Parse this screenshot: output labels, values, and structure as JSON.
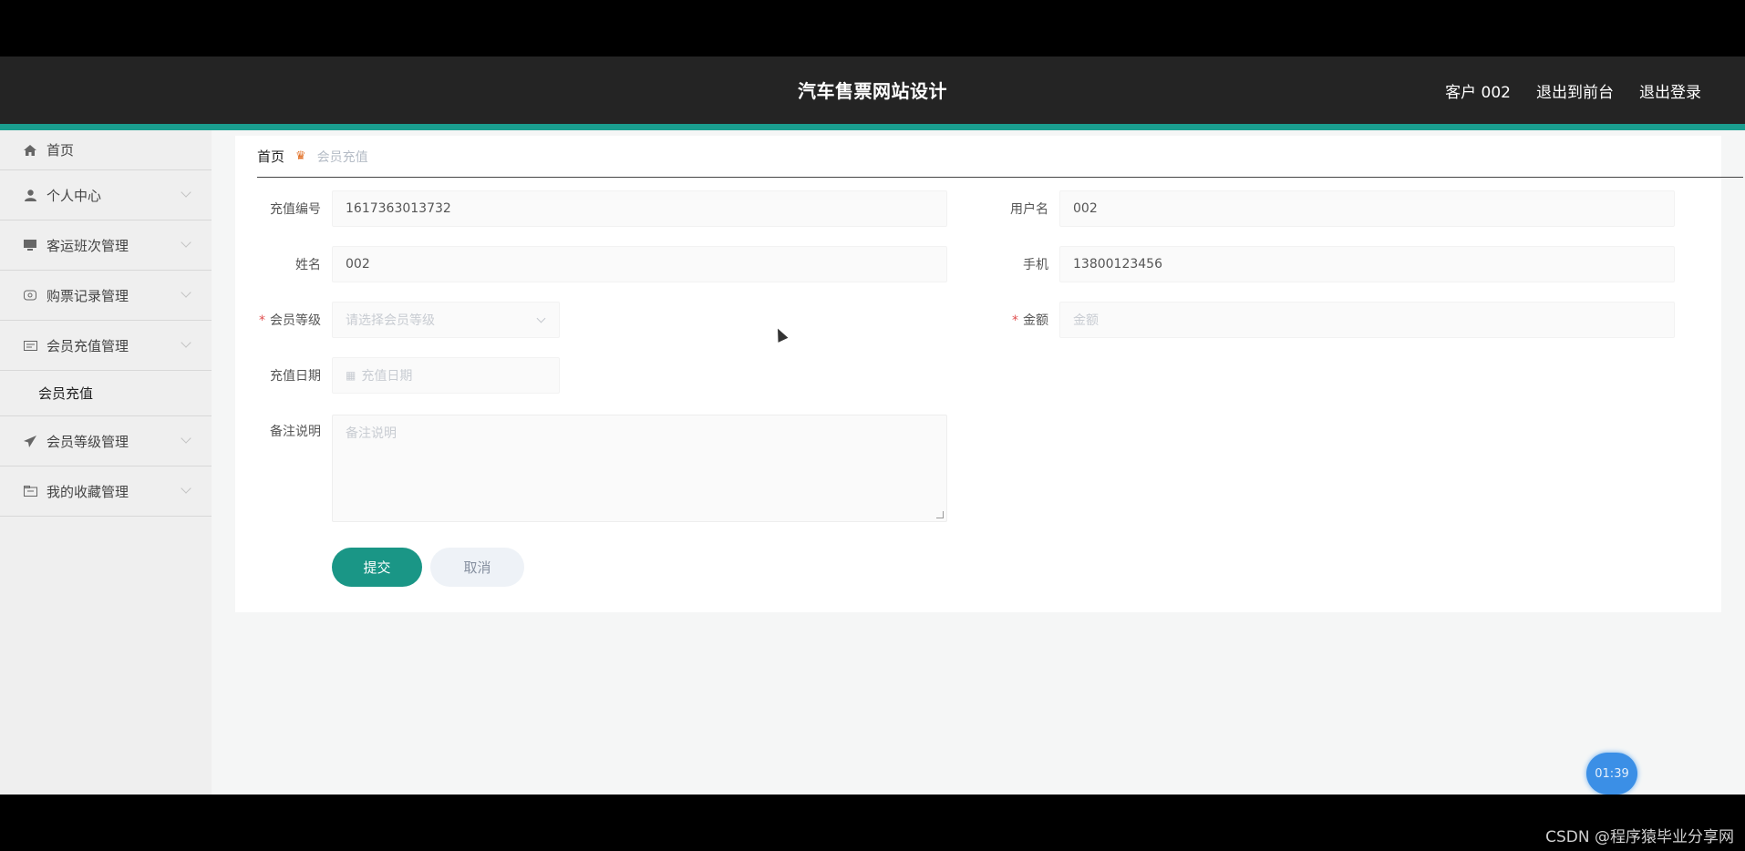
{
  "header": {
    "title": "汽车售票网站设计",
    "user": "客户 002",
    "back_to_front": "退出到前台",
    "logout": "退出登录"
  },
  "sidebar": {
    "items": [
      {
        "label": "首页",
        "icon": "home-icon"
      },
      {
        "label": "个人中心",
        "icon": "user-icon"
      },
      {
        "label": "客运班次管理",
        "icon": "monitor-icon"
      },
      {
        "label": "购票记录管理",
        "icon": "ticket-icon"
      },
      {
        "label": "会员充值管理",
        "icon": "card-icon"
      },
      {
        "label": "会员等级管理",
        "icon": "send-icon"
      },
      {
        "label": "我的收藏管理",
        "icon": "folder-icon"
      }
    ],
    "sub_item": "会员充值"
  },
  "breadcrumb": {
    "home": "首页",
    "current": "会员充值"
  },
  "form": {
    "recharge_no_label": "充值编号",
    "recharge_no_value": "1617363013732",
    "username_label": "用户名",
    "username_value": "002",
    "name_label": "姓名",
    "name_value": "002",
    "phone_label": "手机",
    "phone_value": "13800123456",
    "level_label": "会员等级",
    "level_placeholder": "请选择会员等级",
    "amount_label": "金额",
    "amount_placeholder": "金额",
    "date_label": "充值日期",
    "date_placeholder": "充值日期",
    "remark_label": "备注说明",
    "remark_placeholder": "备注说明",
    "submit": "提交",
    "cancel": "取消"
  },
  "timer": "01:39",
  "watermark": "CSDN @程序猿毕业分享网",
  "colors": {
    "accent": "#1a9e8f",
    "submit_button": "#1a9686",
    "topbar": "#242424"
  }
}
